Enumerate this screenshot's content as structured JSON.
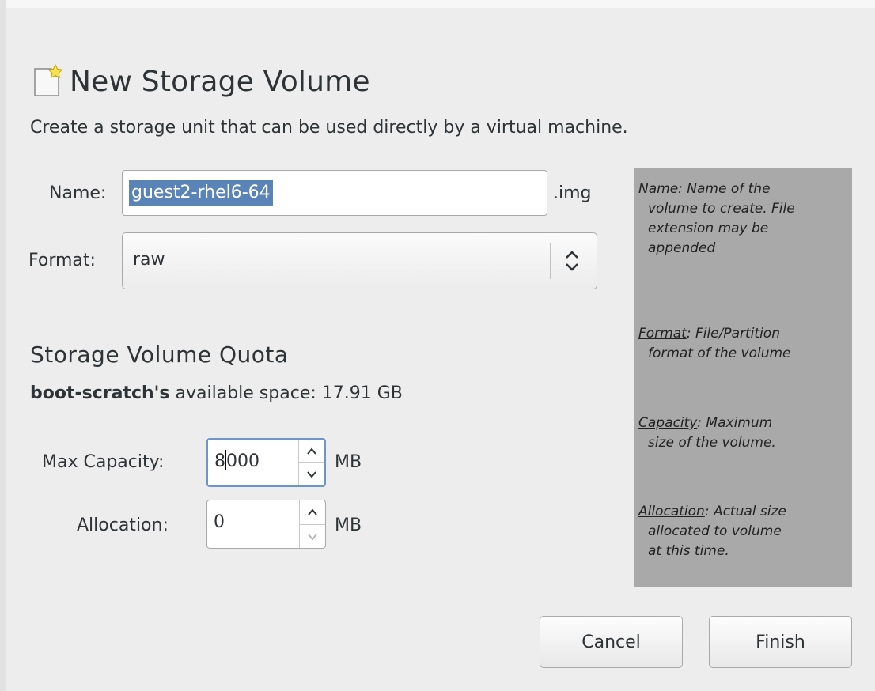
{
  "window": {
    "title": "New Storage Volume",
    "subtitle": "Create a storage unit that can be used directly by a virtual machine."
  },
  "form": {
    "name_label": "Name:",
    "name_value": "guest2-rhel6-64",
    "name_extension": ".img",
    "format_label": "Format:",
    "format_value": "raw"
  },
  "quota": {
    "title": "Storage Volume Quota",
    "pool_name": "boot-scratch's",
    "available_text": "available space: 17.91 GB",
    "max_capacity_label": "Max Capacity:",
    "max_capacity_before_caret": "8",
    "max_capacity_after_caret": "000",
    "max_capacity_unit": "MB",
    "allocation_label": "Allocation:",
    "allocation_value": "0",
    "allocation_unit": "MB"
  },
  "help": {
    "name_term": "Name",
    "name_l1": ": Name of the",
    "name_l2": "volume to create. File",
    "name_l3": "extension may be",
    "name_l4": "appended",
    "format_term": "Format",
    "format_l1": ": File/Partition",
    "format_l2": "format of the volume",
    "capacity_term": "Capacity",
    "capacity_l1": ": Maximum",
    "capacity_l2": "size of the volume.",
    "allocation_term": "Allocation",
    "allocation_l1": ": Actual size",
    "allocation_l2": "allocated to volume",
    "allocation_l3": "at this time."
  },
  "buttons": {
    "cancel": "Cancel",
    "finish": "Finish"
  },
  "colors": {
    "selection": "#5a83b8",
    "help_panel": "#a9a9a9",
    "window_bg": "#ededed"
  }
}
